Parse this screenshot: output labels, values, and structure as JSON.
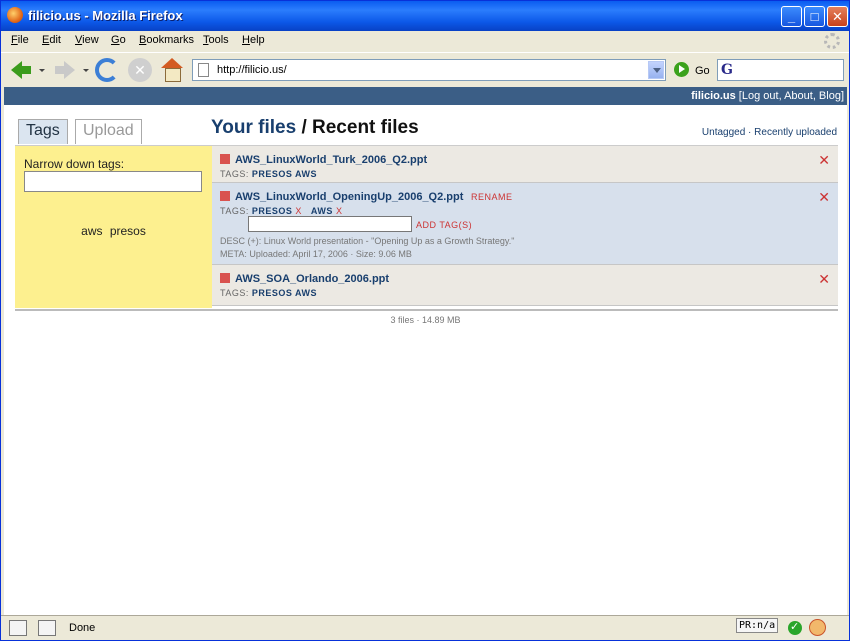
{
  "window": {
    "title": "filicio.us - Mozilla Firefox"
  },
  "menu": {
    "file": "ile",
    "edit": "dit",
    "view": "iew",
    "go": "o",
    "bookmarks": "ookmarks",
    "tools": "ools",
    "help": "elp"
  },
  "menu_keys": {
    "file": "F",
    "edit": "E",
    "view": "V",
    "go": "G",
    "bookmarks": "B",
    "tools": "T",
    "help": "H"
  },
  "nav": {
    "url": "http://filicio.us/",
    "go_label": "Go"
  },
  "site": {
    "name": "filicio.us",
    "links": " [Log out, About, Blog]"
  },
  "tabs": {
    "tags": "Tags",
    "upload": "Upload"
  },
  "heading": {
    "your_files": "Your files",
    "separator": " / ",
    "recent": "Recent files"
  },
  "filters": "Untagged · Recently uploaded",
  "sidebar": {
    "narrow_label": "Narrow down tags:",
    "tags": "aws presos"
  },
  "files": [
    {
      "name": "AWS_LinuxWorld_Turk_2006_Q2.ppt",
      "tags_label": "TAGS:",
      "tags": "PRESOS AWS",
      "delete": "✕"
    },
    {
      "name": "AWS_LinuxWorld_OpeningUp_2006_Q2.ppt",
      "rename": "RENAME",
      "tags_label": "TAGS:",
      "tag1": "PRESOS",
      "tag2": "AWS",
      "remove": "X",
      "add_tag": "ADD TAG(S)",
      "desc": "DESC (+): Linux World presentation - \"Opening Up as a Growth Strategy.\"",
      "meta": "META: Uploaded: April 17, 2006 · Size: 9.06 MB",
      "delete": "✕"
    },
    {
      "name": "AWS_SOA_Orlando_2006.ppt",
      "tags_label": "TAGS:",
      "tags": "PRESOS AWS",
      "delete": "✕"
    }
  ],
  "summary": "3 files · 14.89 MB",
  "status": {
    "text": "Done",
    "pr": "PR:n/a"
  },
  "colors": {
    "sidebar_bg": "#fdf08f",
    "row_highlight": "#d7e0ec",
    "accent_blue": "#193f6e",
    "delete_red": "#cc3333"
  }
}
